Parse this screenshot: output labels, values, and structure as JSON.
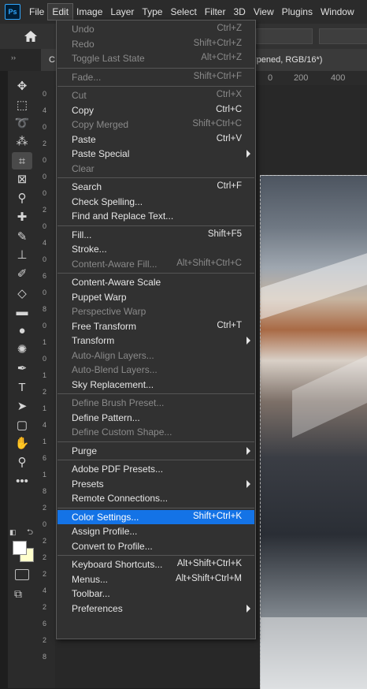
{
  "menubar": {
    "logo": "Ps",
    "items": [
      "File",
      "Edit",
      "Image",
      "Layer",
      "Type",
      "Select",
      "Filter",
      "3D",
      "View",
      "Plugins",
      "Window"
    ]
  },
  "tab": {
    "title": "rpened, RGB/16*)",
    "close": "×",
    "doc_prefix": "C"
  },
  "ruler": {
    "h": [
      "0",
      "200",
      "400"
    ],
    "v": [
      "0",
      "4",
      "0",
      "2",
      "0",
      "0",
      "0",
      "2",
      "0",
      "4",
      "0",
      "6",
      "0",
      "8",
      "0",
      "1",
      "0",
      "1",
      "2",
      "1",
      "4",
      "1",
      "6",
      "1",
      "8",
      "2",
      "0",
      "2",
      "2",
      "2",
      "4",
      "2",
      "6",
      "2",
      "8"
    ]
  },
  "edit_menu": {
    "groups": [
      [
        {
          "label": "Undo",
          "shortcut": "Ctrl+Z",
          "disabled": true
        },
        {
          "label": "Redo",
          "shortcut": "Shift+Ctrl+Z",
          "disabled": true
        },
        {
          "label": "Toggle Last State",
          "shortcut": "Alt+Ctrl+Z",
          "disabled": true
        }
      ],
      [
        {
          "label": "Fade...",
          "shortcut": "Shift+Ctrl+F",
          "disabled": true
        }
      ],
      [
        {
          "label": "Cut",
          "shortcut": "Ctrl+X",
          "disabled": true
        },
        {
          "label": "Copy",
          "shortcut": "Ctrl+C",
          "disabled": false
        },
        {
          "label": "Copy Merged",
          "shortcut": "Shift+Ctrl+C",
          "disabled": true
        },
        {
          "label": "Paste",
          "shortcut": "Ctrl+V",
          "disabled": false
        },
        {
          "label": "Paste Special",
          "shortcut": "",
          "disabled": false,
          "submenu": true
        },
        {
          "label": "Clear",
          "shortcut": "",
          "disabled": true
        }
      ],
      [
        {
          "label": "Search",
          "shortcut": "Ctrl+F",
          "disabled": false
        },
        {
          "label": "Check Spelling...",
          "shortcut": "",
          "disabled": false
        },
        {
          "label": "Find and Replace Text...",
          "shortcut": "",
          "disabled": false
        }
      ],
      [
        {
          "label": "Fill...",
          "shortcut": "Shift+F5",
          "disabled": false
        },
        {
          "label": "Stroke...",
          "shortcut": "",
          "disabled": false
        },
        {
          "label": "Content-Aware Fill...",
          "shortcut": "Alt+Shift+Ctrl+C",
          "disabled": true
        }
      ],
      [
        {
          "label": "Content-Aware Scale",
          "shortcut": "",
          "disabled": false
        },
        {
          "label": "Puppet Warp",
          "shortcut": "",
          "disabled": false
        },
        {
          "label": "Perspective Warp",
          "shortcut": "",
          "disabled": true
        },
        {
          "label": "Free Transform",
          "shortcut": "Ctrl+T",
          "disabled": false
        },
        {
          "label": "Transform",
          "shortcut": "",
          "disabled": false,
          "submenu": true
        },
        {
          "label": "Auto-Align Layers...",
          "shortcut": "",
          "disabled": true
        },
        {
          "label": "Auto-Blend Layers...",
          "shortcut": "",
          "disabled": true
        },
        {
          "label": "Sky Replacement...",
          "shortcut": "",
          "disabled": false
        }
      ],
      [
        {
          "label": "Define Brush Preset...",
          "shortcut": "",
          "disabled": true
        },
        {
          "label": "Define Pattern...",
          "shortcut": "",
          "disabled": false
        },
        {
          "label": "Define Custom Shape...",
          "shortcut": "",
          "disabled": true
        }
      ],
      [
        {
          "label": "Purge",
          "shortcut": "",
          "disabled": false,
          "submenu": true
        }
      ],
      [
        {
          "label": "Adobe PDF Presets...",
          "shortcut": "",
          "disabled": false
        },
        {
          "label": "Presets",
          "shortcut": "",
          "disabled": false,
          "submenu": true
        },
        {
          "label": "Remote Connections...",
          "shortcut": "",
          "disabled": false
        }
      ],
      [
        {
          "label": "Color Settings...",
          "shortcut": "Shift+Ctrl+K",
          "disabled": false,
          "highlighted": true
        },
        {
          "label": "Assign Profile...",
          "shortcut": "",
          "disabled": false
        },
        {
          "label": "Convert to Profile...",
          "shortcut": "",
          "disabled": false
        }
      ],
      [
        {
          "label": "Keyboard Shortcuts...",
          "shortcut": "Alt+Shift+Ctrl+K",
          "disabled": false
        },
        {
          "label": "Menus...",
          "shortcut": "Alt+Shift+Ctrl+M",
          "disabled": false
        },
        {
          "label": "Toolbar...",
          "shortcut": "",
          "disabled": false
        },
        {
          "label": "Preferences",
          "shortcut": "",
          "disabled": false,
          "submenu": true
        }
      ]
    ]
  },
  "tools": [
    {
      "icon": "move-icon",
      "glyph": "✥"
    },
    {
      "icon": "marquee-icon",
      "glyph": "⬚"
    },
    {
      "icon": "lasso-icon",
      "glyph": "➰"
    },
    {
      "icon": "quick-select-icon",
      "glyph": "⁂"
    },
    {
      "icon": "crop-icon",
      "glyph": "⌗"
    },
    {
      "icon": "frame-icon",
      "glyph": "⊠"
    },
    {
      "icon": "eyedropper-icon",
      "glyph": "⚲"
    },
    {
      "icon": "healing-brush-icon",
      "glyph": "✚"
    },
    {
      "icon": "brush-icon",
      "glyph": "✎"
    },
    {
      "icon": "stamp-icon",
      "glyph": "⊥"
    },
    {
      "icon": "history-brush-icon",
      "glyph": "✐"
    },
    {
      "icon": "eraser-icon",
      "glyph": "◇"
    },
    {
      "icon": "gradient-icon",
      "glyph": "▬"
    },
    {
      "icon": "blur-icon",
      "glyph": "●"
    },
    {
      "icon": "dodge-icon",
      "glyph": "✺"
    },
    {
      "icon": "pen-icon",
      "glyph": "✒"
    },
    {
      "icon": "type-icon",
      "glyph": "T"
    },
    {
      "icon": "path-select-icon",
      "glyph": "➤"
    },
    {
      "icon": "shape-icon",
      "glyph": "▢"
    },
    {
      "icon": "hand-icon",
      "glyph": "✋"
    },
    {
      "icon": "zoom-icon",
      "glyph": "⚲"
    },
    {
      "icon": "more-tools-icon",
      "glyph": "•••"
    }
  ],
  "colors": {
    "accent": "#1473e6",
    "foreground": "#ffffff",
    "background": "#ffffcc"
  }
}
